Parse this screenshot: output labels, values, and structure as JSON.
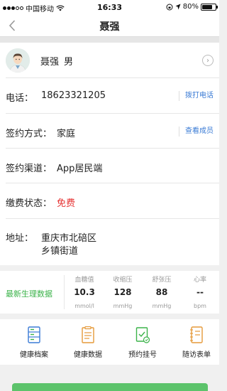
{
  "status_bar": {
    "carrier": "中国移动",
    "time": "16:33",
    "battery": "80%",
    "battery_level": 0.8
  },
  "nav": {
    "title": "聂强"
  },
  "profile": {
    "name": "聂强",
    "gender": "男"
  },
  "fields": {
    "phone_label": "电话：",
    "phone_value": "18623321205",
    "phone_action": "拨打电话",
    "sign_type_label": "签约方式：",
    "sign_type_value": "家庭",
    "sign_type_action": "查看成员",
    "channel_label": "签约渠道：",
    "channel_value": "App居民端",
    "payment_label": "缴费状态：",
    "payment_value": "免费",
    "address_label": "地址：",
    "address_line1": "重庆市北碚区",
    "address_line2": "乡镇街道"
  },
  "metrics": {
    "title": "最新生理数据",
    "items": [
      {
        "label": "血糖值",
        "value": "10.3",
        "unit": "mmol/l"
      },
      {
        "label": "收缩压",
        "value": "128",
        "unit": "mmHg"
      },
      {
        "label": "舒张压",
        "value": "88",
        "unit": "mmHg"
      },
      {
        "label": "心率",
        "value": "--",
        "unit": "bpm"
      }
    ]
  },
  "features": [
    {
      "label": "健康档案",
      "icon": "health-record-icon"
    },
    {
      "label": "健康数据",
      "icon": "health-data-icon"
    },
    {
      "label": "预约挂号",
      "icon": "appointment-icon"
    },
    {
      "label": "随访表单",
      "icon": "followup-form-icon"
    }
  ],
  "colors": {
    "accent_green": "#3bb34a",
    "link_blue": "#3a7bd5",
    "alert_red": "#e63232",
    "button_green": "#5cc36b"
  }
}
